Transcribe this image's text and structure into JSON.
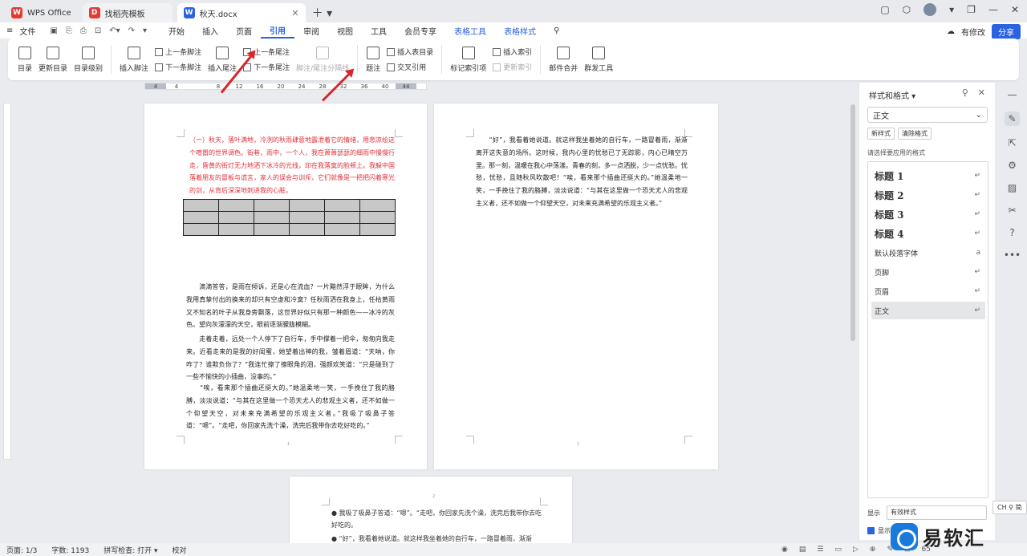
{
  "tabs": [
    {
      "label": "WPS Office",
      "color": "#e33b32",
      "glyph": "W"
    },
    {
      "label": "找稻壳模板",
      "color": "#e33b32",
      "glyph": "D"
    },
    {
      "label": "秋天.docx",
      "color": "#2a62e0",
      "glyph": "W"
    }
  ],
  "menu": {
    "file": "文件",
    "items": [
      "开始",
      "插入",
      "页面",
      "引用",
      "审阅",
      "视图",
      "工具",
      "会员专享"
    ],
    "special": [
      "表格工具",
      "表格样式"
    ],
    "active": "引用",
    "edit_status": "有修改",
    "share": "分享"
  },
  "ribbon": {
    "toc": "目录",
    "update_toc": "更新目录",
    "toc_level": "目录级别",
    "insert_footnote": "插入脚注",
    "prev_footnote": "上一条脚注",
    "next_footnote": "下一条脚注",
    "insert_endnote": "插入尾注",
    "prev_endnote": "上一条尾注",
    "next_endnote": "下一条尾注",
    "footnote_sep": "脚注/尾注分隔线",
    "caption": "题注",
    "insert_tof": "插入表目录",
    "cross_ref": "交叉引用",
    "mark_index": "标记索引项",
    "insert_index": "插入索引",
    "update_index": "更新索引",
    "mail_merge": "邮件合并",
    "group_send": "群发工具"
  },
  "ruler": [
    "4",
    "4",
    "8",
    "12",
    "16",
    "20",
    "24",
    "28",
    "32",
    "36",
    "40",
    "44"
  ],
  "page1": {
    "red_para": "（一）秋天，落叶满地，冷冽的秋雨肆意地露泄着它的情绪，用悲凉绘这个喧嚣的世界调色。街巷，雨中，一个人，我在萧萧瑟瑟的细雨中慢慢行走，昏黄的街灯无力地洒下冰冷的光线，印在我落寞的脸颊上。我躲中国落着朋友的冒板与谎言，家人的误会与训斥，它们就像是一把把闪着寒光的剑，从背后深深地刺进我的心脏。",
    "para1": "　　滴滴答答，是雨在倾诉，还是心在流血？一片黯然浮于眼眸，为什么我用真挚付出的换来的却只有空虚和冷寞？任秋雨洒在我身上，任枯黄雨又不知名的叶子从我身旁飘落，这世界好似只有那一种颜色——冰冷的灰色。望向灰濛濛的天空，眼前逐渐朦胧模糊。",
    "para2": "　　走着走着，远处一个人停下了自行车，手中撑着一把伞，匆匆向我走来。近看走来的是我的好闺蜜，她望着出神的我，皱着眉道：“天呐，你咋了？谁欺负你了？”我连忙擦了擦眼角的泪，强颜欢笑道：“只是碰到了一些不愉快的小插曲，没事的。”",
    "para3": "　　“唉，看来那个插曲还挺大的。”她温柔地一笑，一手挽住了我的胳膊，淡淡说道：“与其在这里做一个恐天尤人的悲观主义者，还不如做一个仰望天空，对未来充满希望的乐观主义者。”我吸了吸鼻子答道：“嗯”。“走吧，你回家先洗个澡，洗完后我带你去吃好吃的。”",
    "page_num": "1"
  },
  "page2": {
    "para": "　　“好”，我看着她说道。就这样我坐着她的自行车，一路冒着雨，渐渐离开这失意的场所。这时候，我内心里的忧愁已了无踪影，内心已晴空万里。那一刻，温暖在我心中荡漾。青春的刻，多一点洒脱，少一点忧愁。忧愁，忧愁，且随秋风吹散吧！“唉，看来那个插曲还挺大的。”她温柔地一笑，一手挽住了我的胳膊，淡淡说道：“与其在这里做一个恐天尤人的悲观主义者，还不如做一个仰望天空，对未来充满希望的乐观主义者。”",
    "page_num": "1"
  },
  "page3": {
    "bullet1": "我吸了吸鼻子答道：“嗯”。“走吧，你回家先洗个澡，洗完后我带你去吃好吃的。",
    "bullet2": "“好”，我看着她说道。就这样我坐着她的自行车，一路冒着雨，渐渐",
    "page_num": "2"
  },
  "panel": {
    "title": "样式和格式",
    "current": "正文",
    "new_style": "新样式",
    "clear_format": "清除格式",
    "prompt": "请选择要应用的格式",
    "styles": [
      {
        "name": "标题 1",
        "sym": "↵"
      },
      {
        "name": "标题 2",
        "sym": "↵"
      },
      {
        "name": "标题 3",
        "sym": "↵"
      },
      {
        "name": "标题 4",
        "sym": "↵"
      },
      {
        "name": "默认段落字体",
        "sym": "a"
      },
      {
        "name": "页脚",
        "sym": "↵"
      },
      {
        "name": "页眉",
        "sym": "↵"
      },
      {
        "name": "正文",
        "sym": "↵"
      }
    ],
    "display_label": "显示",
    "display_value": "有效样式",
    "preview_label": "显示"
  },
  "ime": "CH ⚲ 简",
  "status": {
    "page": "页面: 1/3",
    "words": "字数: 1193",
    "spell": "拼写检查: 打开",
    "proof": "校对",
    "zoom": "65"
  },
  "watermark": "易软汇"
}
